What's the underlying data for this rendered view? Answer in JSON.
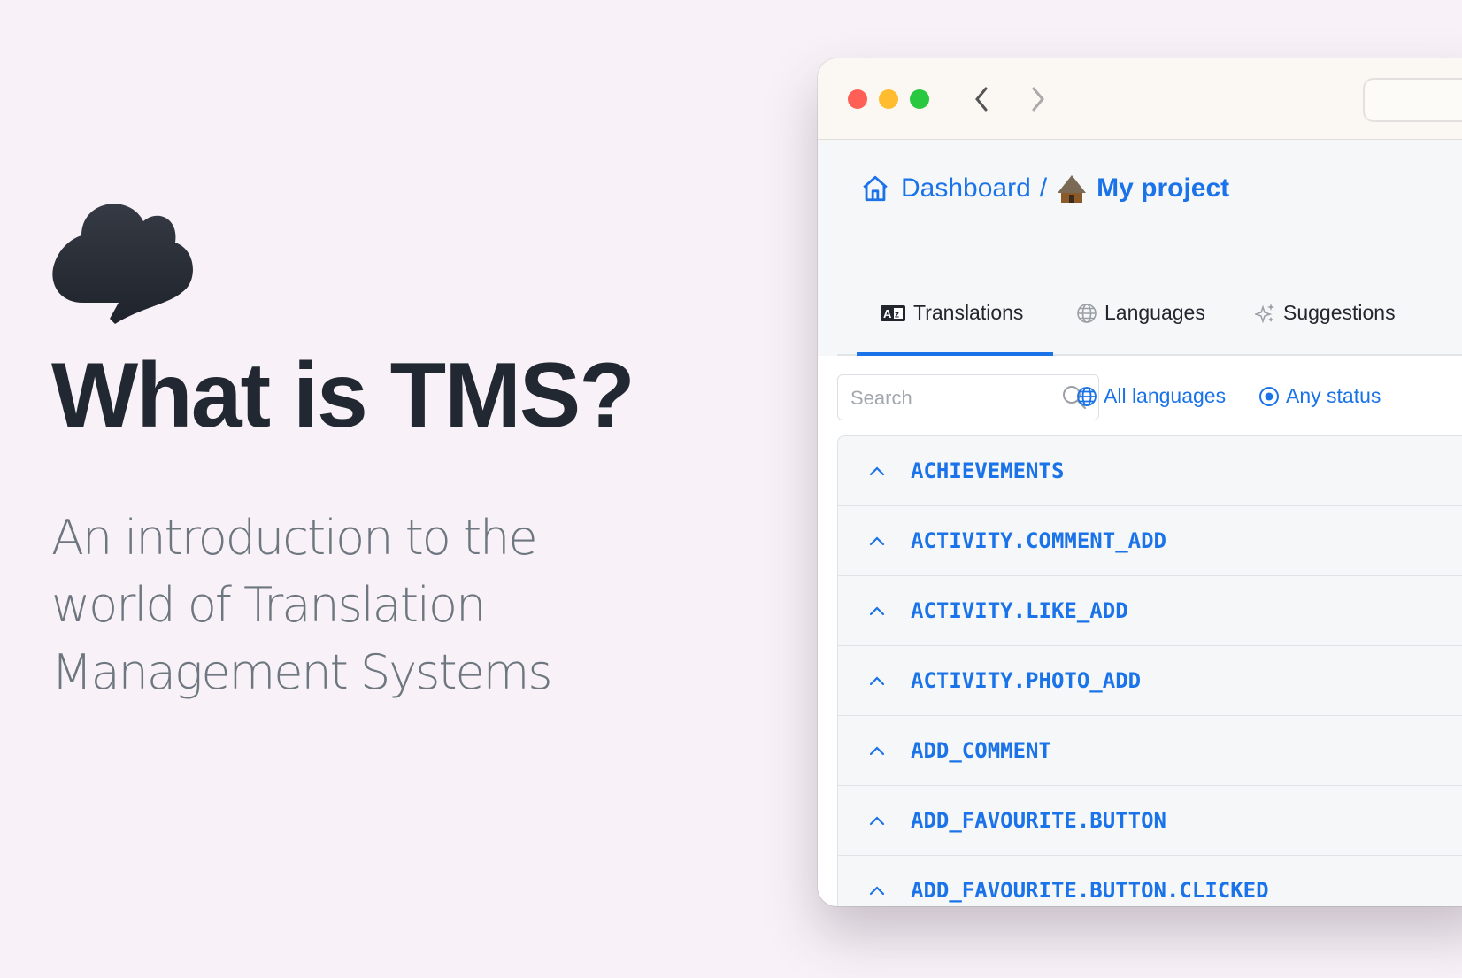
{
  "hero": {
    "logo": "speech-cloud-logo",
    "title": "What is TMS?",
    "subtitle": "An introduction to the world of Translation Management Systems"
  },
  "window": {
    "controls": [
      "close",
      "minimize",
      "maximize"
    ],
    "nav": {
      "back": "chevron-left-icon",
      "forward": "chevron-right-icon"
    },
    "breadcrumb": {
      "home_label": "Dashboard",
      "separator": "/",
      "project_label": "My project",
      "project_icon": "hut-emoji"
    },
    "tabs": [
      {
        "label": "Translations",
        "icon": "translate-az-icon",
        "active": true
      },
      {
        "label": "Languages",
        "icon": "globe-icon",
        "active": false
      },
      {
        "label": "Suggestions",
        "icon": "sparkles-icon",
        "active": false
      }
    ],
    "search": {
      "placeholder": "Search"
    },
    "filters": {
      "languages": "All languages",
      "status": "Any status"
    },
    "keys": [
      "ACHIEVEMENTS",
      "ACTIVITY.COMMENT_ADD",
      "ACTIVITY.LIKE_ADD",
      "ACTIVITY.PHOTO_ADD",
      "ADD_COMMENT",
      "ADD_FAVOURITE.BUTTON",
      "ADD_FAVOURITE.BUTTON.CLICKED"
    ],
    "colors": {
      "accent": "#1a73e8",
      "title": "#212831",
      "subtitle": "#6e767f"
    }
  }
}
